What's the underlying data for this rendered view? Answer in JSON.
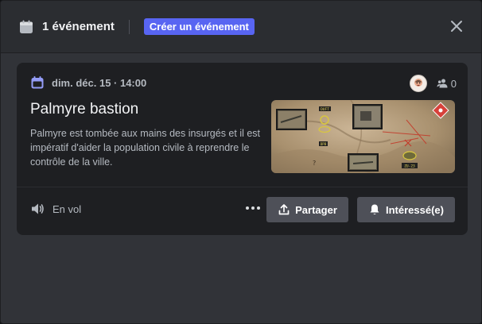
{
  "header": {
    "title": "1 événement",
    "create_label": "Créer un événement",
    "icon": "calendar-icon"
  },
  "event": {
    "date": "dim. déc. 15 · 14:00",
    "title": "Palmyre bastion",
    "description": "Palmyre est tombée aux mains des insurgés et il est impératif d'aider la population civile à reprendre le contrôle de la ville.",
    "interested_count": "0",
    "location": "En vol",
    "cover_labels": [
      "DUFT",
      "DPB",
      "ZU-23"
    ]
  },
  "actions": {
    "share_label": "Partager",
    "interested_label": "Intéressé(e)"
  },
  "colors": {
    "accent": "#5865f2",
    "calendar_icon": "#949cf7",
    "button": "#4e5058"
  }
}
